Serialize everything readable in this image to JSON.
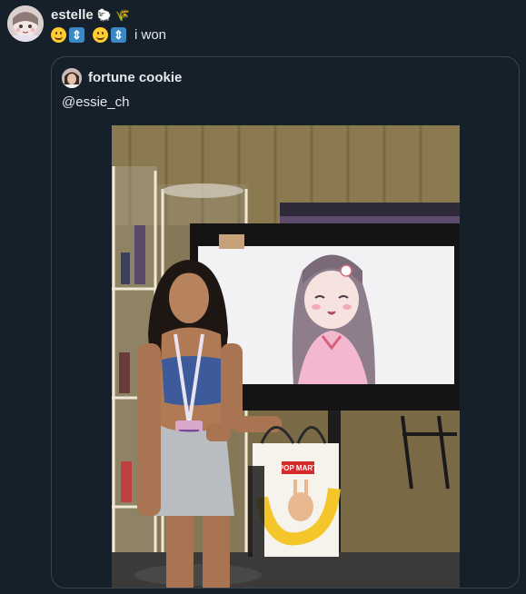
{
  "post": {
    "author_name": "estelle",
    "name_emojis": [
      "sheep-emoji",
      "sprout-emoji"
    ],
    "text_emojis": [
      "slightly-smiling-face",
      "up-down-arrow",
      "slightly-smiling-face",
      "up-down-arrow"
    ],
    "text": "i won"
  },
  "quoted_post": {
    "author_name": "fortune cookie",
    "text": "@essie_ch",
    "media": {
      "type": "photo",
      "visible_text": "POP MART"
    }
  },
  "colors": {
    "background": "#15202b",
    "text": "#e7e9ea",
    "border": "#38444d",
    "emoji_blue": "#3b88c3"
  }
}
